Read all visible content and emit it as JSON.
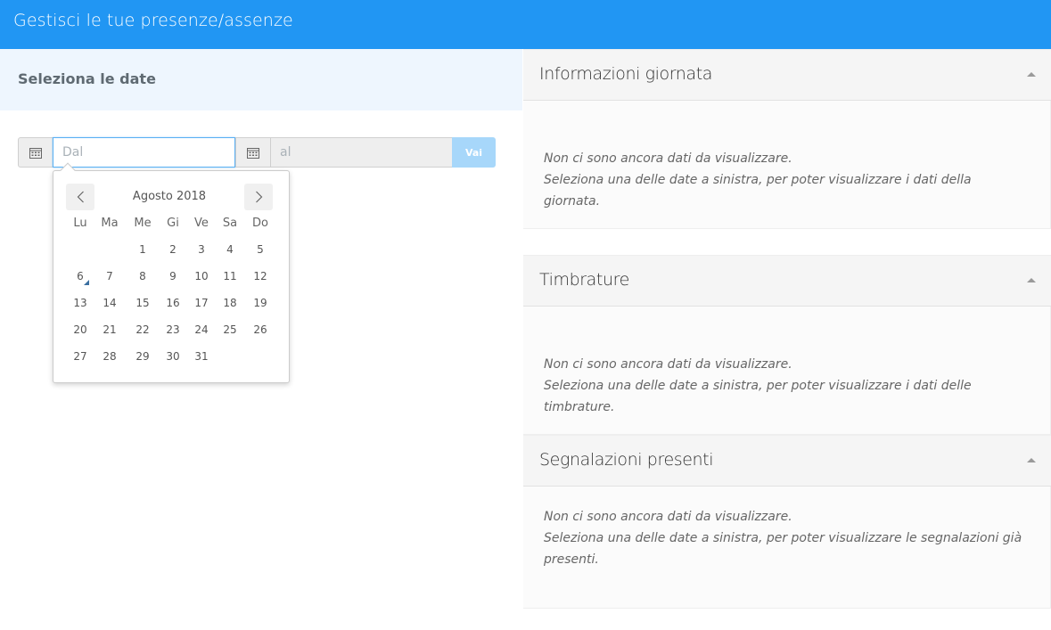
{
  "header": {
    "title": "Gestisci le tue presenze/assenze"
  },
  "date_selection": {
    "heading": "Seleziona le date",
    "from_placeholder": "Dal",
    "to_placeholder": "al",
    "go_label": "Vai"
  },
  "calendar": {
    "month_label": "Agosto 2018",
    "weekdays": [
      "Lu",
      "Ma",
      "Me",
      "Gi",
      "Ve",
      "Sa",
      "Do"
    ],
    "days": [
      1,
      2,
      3,
      4,
      5,
      6,
      7,
      8,
      9,
      10,
      11,
      12,
      13,
      14,
      15,
      16,
      17,
      18,
      19,
      20,
      21,
      22,
      23,
      24,
      25,
      26,
      27,
      28,
      29,
      30,
      31
    ],
    "first_weekday_index": 2,
    "today": 6
  },
  "panels": [
    {
      "title": "Informazioni giornata",
      "line1": "Non ci sono ancora dati da visualizzare.",
      "line2": "Seleziona una delle date a sinistra, per poter visualizzare i dati della giornata."
    },
    {
      "title": "Timbrature",
      "line1": "Non ci sono ancora dati da visualizzare.",
      "line2": "Seleziona una delle date a sinistra, per poter visualizzare i dati delle timbrature."
    },
    {
      "title": "Segnalazioni presenti",
      "line1": "Non ci sono ancora dati da visualizzare.",
      "line2": "Seleziona una delle date a sinistra, per poter visualizzare le segnalazioni già presenti."
    }
  ]
}
